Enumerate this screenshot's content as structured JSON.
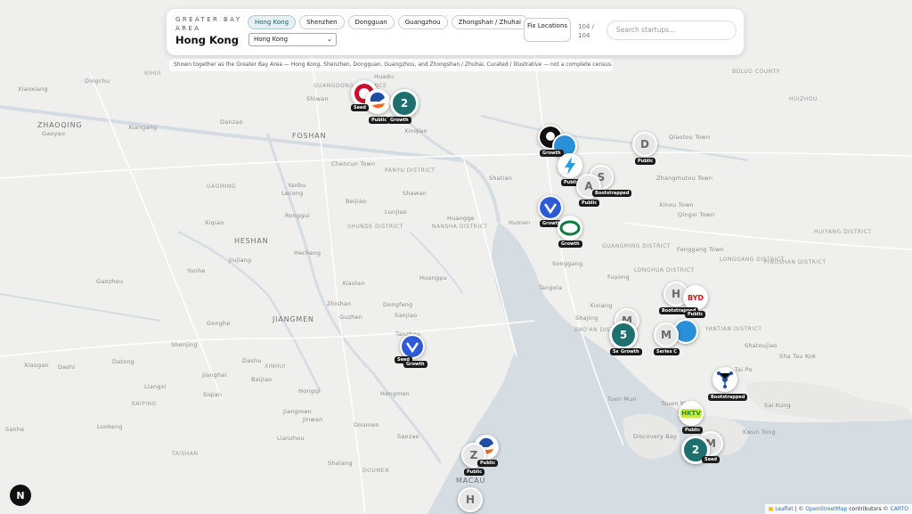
{
  "header": {
    "kicker": "GREATER BAY AREA",
    "title": "Hong Kong",
    "tabs": [
      {
        "label": "Hong Kong",
        "active": true
      },
      {
        "label": "Shenzhen",
        "active": false
      },
      {
        "label": "Dongguan",
        "active": false
      },
      {
        "label": "Guangzhou",
        "active": false
      },
      {
        "label": "Zhongshan / Zhuhai",
        "active": false
      }
    ],
    "city_select": "Hong Kong",
    "fix_label": "Fix Locations",
    "count": "104 / 104",
    "search_placeholder": "Search startups..."
  },
  "note": "Shown together as the Greater Bay Area — Hong Kong, Shenzhen, Dongguan, Guangzhou, and Zhongshan / Zhuhai. Curated / illustrative — not a complete census.",
  "places": {
    "cities": [
      "FOSHAN",
      "JIANGMEN",
      "MACAU",
      "ZHAOQING",
      "HESHAN"
    ],
    "districts": [
      "PANYU DISTRICT",
      "SHUNDE DISTRICT",
      "NANSHA DISTRICT",
      "BAO'AN DISTRICT",
      "LONGHUA DISTRICT",
      "GUANGMING DISTRICT",
      "YANTIAN DISTRICT",
      "HUIYANG DISTRICT",
      "LONGGANG DISTRICT",
      "PINGSHAN DISTRICT",
      "HUIZHOU",
      "BOLUO COUNTY",
      "XINHUI",
      "DOUMEN",
      "TAISHAN",
      "KAIPING",
      "GAOMING",
      "SIHUI",
      "GUANGDONG PROVINCE"
    ],
    "towns": [
      "Dingchu",
      "Xiaoxiang",
      "Gaoyao",
      "Xiangang",
      "Danzao",
      "Xinqiao",
      "Chencun Town",
      "Lecong",
      "Beijiao",
      "Ronggui",
      "Lunjiao",
      "Shawan",
      "Huangge",
      "Humen",
      "Shatian",
      "Qiaotou Town",
      "Zhangmutou Town",
      "Xinxu Town",
      "Qingxi Town",
      "Fenggang Town",
      "Huadu",
      "Shiwan",
      "Yanbu",
      "Xiqiao",
      "Jiujiang",
      "Yunhe",
      "Gaozhou",
      "Hecheng",
      "Zhishan",
      "Guzhen",
      "Xiaolan",
      "Dongfeng",
      "Huangpu",
      "Sanjiao",
      "Tanzhou",
      "Hengmen",
      "Shalang",
      "Doumen",
      "Sanzao",
      "Jinwan",
      "Hongqi",
      "Baijiao",
      "Lianzhou",
      "Gonghe",
      "Shenjing",
      "Siqian",
      "Datong",
      "Dashu",
      "Jianghai",
      "Liangxi",
      "Luokeng",
      "Sanhe",
      "Xiaogan",
      "Dashi",
      "Jiangmen",
      "Tangxia",
      "Tuen Mun",
      "Discovery Bay",
      "Kwun Tong",
      "Tsuen Wan",
      "Sai Kung",
      "Tai Po",
      "Sha Tau Kok",
      "Shatoujiao",
      "Xixiang",
      "Shajing",
      "Fuyong",
      "Songgang"
    ],
    "water": [
      "Pearl River"
    ]
  },
  "markers": [
    {
      "kind": "cluster",
      "label": "2"
    },
    {
      "kind": "cluster",
      "label": "5"
    },
    {
      "kind": "cluster",
      "label": "2"
    },
    {
      "kind": "letter",
      "label": "D"
    },
    {
      "kind": "letter",
      "label": "A"
    },
    {
      "kind": "letter",
      "label": "S"
    },
    {
      "kind": "letter",
      "label": "H"
    },
    {
      "kind": "letter",
      "label": "M"
    },
    {
      "kind": "letter",
      "label": "Z"
    },
    {
      "kind": "letter",
      "label": "H"
    },
    {
      "kind": "letter",
      "label": "M"
    }
  ],
  "tags": [
    "Growth",
    "Public",
    "Bootstrapped",
    "Series C",
    "Seed"
  ],
  "marker_labels": {
    "byd": "BYD",
    "hktv": "HKTV",
    "ofo": "OFO"
  },
  "colors": {
    "cluster": "#1e6f6d",
    "water": "#d5dde3",
    "land": "#efefed",
    "tab_active": "#e4f0f1"
  },
  "attribution": {
    "leaflet": "Leaflet",
    "sep": "| ©",
    "osm": "OpenStreetMap",
    "contrib": "contributors ©",
    "carto": "CARTO"
  },
  "corner_logo": "N"
}
